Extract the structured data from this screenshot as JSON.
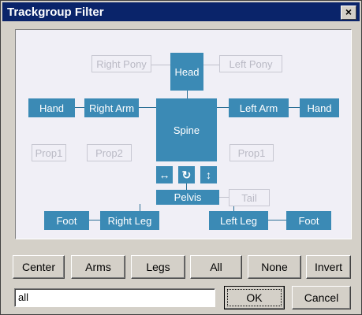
{
  "window": {
    "title": "Trackgroup Filter",
    "close_label": "×"
  },
  "diagram": {
    "right_pony": "Right Pony",
    "head": "Head",
    "left_pony": "Left Pony",
    "hand_right": "Hand",
    "right_arm": "Right Arm",
    "spine": "Spine",
    "left_arm": "Left Arm",
    "hand_left": "Hand",
    "prop1_left": "Prop1",
    "prop2": "Prop2",
    "prop1_right": "Prop1",
    "sym_move": "↔",
    "sym_rotate": "↻",
    "sym_scale": "↕",
    "pelvis": "Pelvis",
    "tail": "Tail",
    "foot_right": "Foot",
    "right_leg": "Right Leg",
    "left_leg": "Left Leg",
    "foot_left": "Foot"
  },
  "buttons": {
    "center": "Center",
    "arms": "Arms",
    "legs": "Legs",
    "all": "All",
    "none": "None",
    "invert": "Invert",
    "ok": "OK",
    "cancel": "Cancel"
  },
  "filter": {
    "value": "all"
  }
}
